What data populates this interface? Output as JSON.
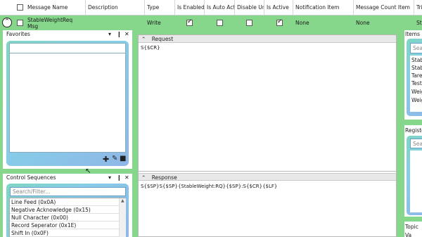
{
  "grid": {
    "columns": [
      "Message Name",
      "Description",
      "Type",
      "Is Enabled",
      "Is Auto Acti",
      "Disable Un",
      "Is Active",
      "Notification Item",
      "Message Count Item",
      "Tri"
    ],
    "row": {
      "name_line1": "StableWeightReq",
      "name_line2": "Msg",
      "type": "Write",
      "notification_item": "None",
      "message_count_item": "None",
      "tri": "Stal"
    }
  },
  "favorites": {
    "title": "Favorites"
  },
  "control_sequences": {
    "title": "Control Sequences",
    "search_placeholder": "Search/Filter...",
    "items": [
      "Line Feed (0x0A)",
      "Negative Acknowledge (0x15)",
      "Null Character (0x00)",
      "Record Seperator (0x1E)",
      "Shift In (0x0F)"
    ]
  },
  "request": {
    "title": "Request",
    "text": "S{$CR}"
  },
  "response": {
    "title": "Response",
    "text": "S{$SP}S{$SP}{StableWeight:RQ}{$SP}:S{$CR}{$LF}"
  },
  "items_panel": {
    "title": "Items",
    "search_placeholder": "Sea",
    "items": [
      "Stab",
      "Stab",
      "Tare",
      "Testi",
      "Weig",
      "Weig"
    ]
  },
  "registers_panel": {
    "title": "Register",
    "search_placeholder": "Sea"
  },
  "topic_panel": {
    "title": "Topic Va"
  },
  "colors": {
    "accent_green": "#86d68c",
    "gradient": "#86cde8"
  }
}
